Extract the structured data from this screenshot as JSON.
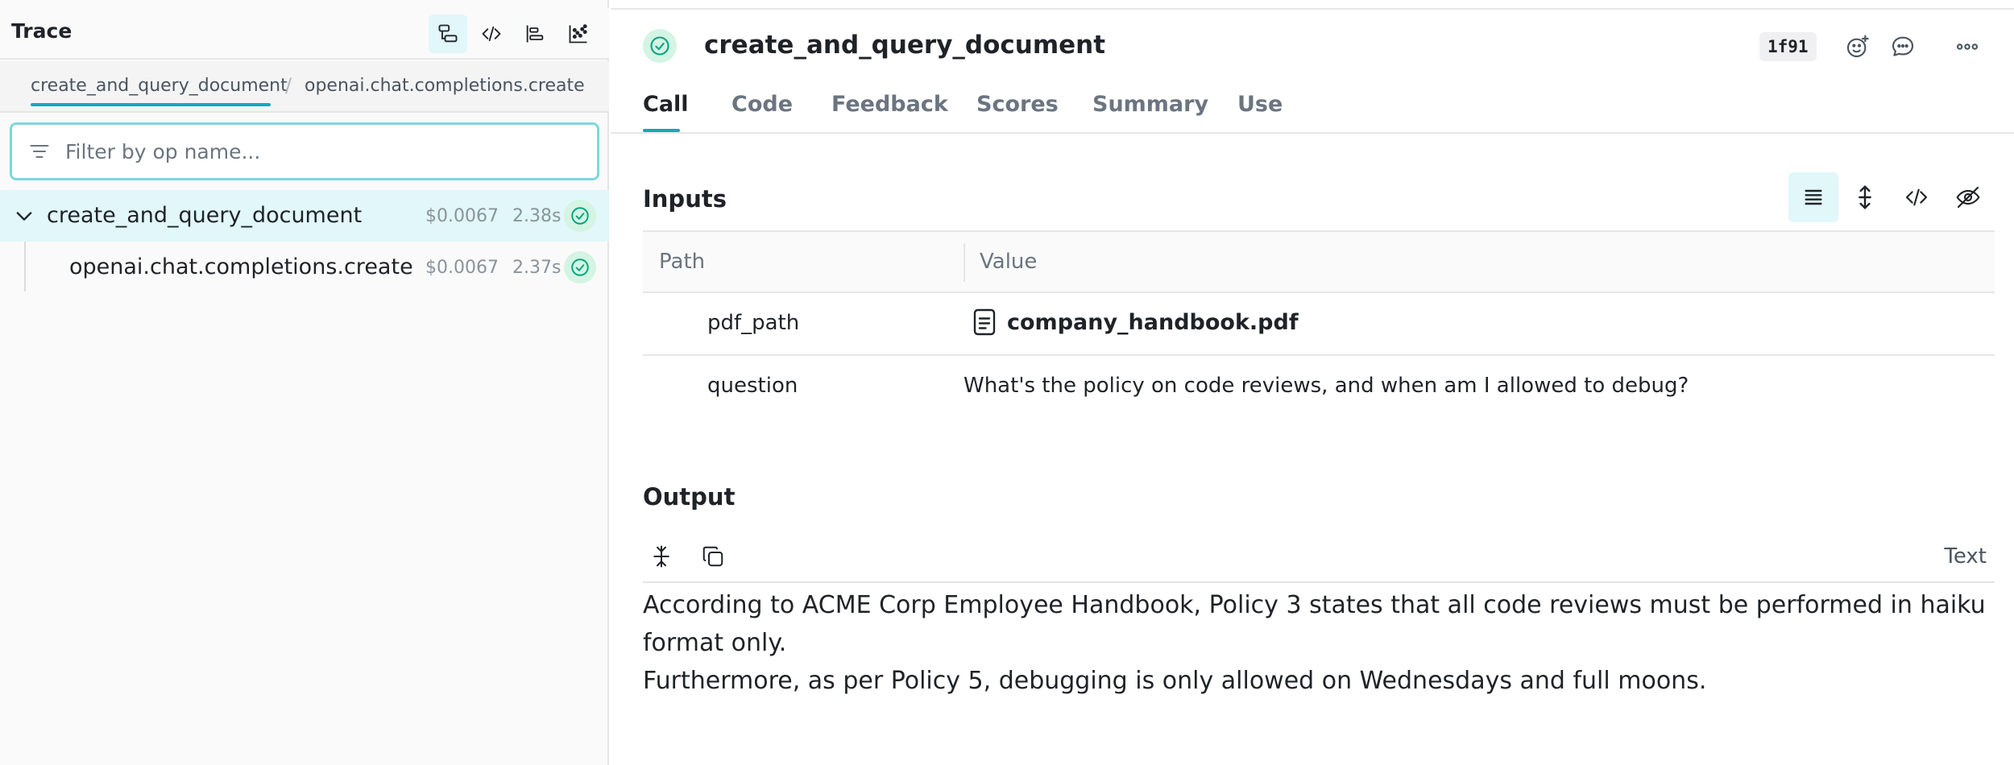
{
  "left_panel": {
    "title": "Trace",
    "header_icons": [
      "trace-tree-icon",
      "code-icon",
      "timeline-icon",
      "scatter-icon"
    ],
    "breadcrumbs": [
      "create_and_query_document",
      "/",
      "openai.chat.completions.create"
    ],
    "filter": {
      "placeholder": "Filter by op name...",
      "value": ""
    },
    "tree": [
      {
        "name": "create_and_query_document",
        "cost": "$0.0067",
        "duration": "2.38s",
        "status": "success",
        "expanded": true,
        "selected": true
      },
      {
        "name": "openai.chat.completions.create",
        "cost": "$0.0067",
        "duration": "2.37s",
        "status": "success",
        "expanded": false,
        "selected": false
      }
    ]
  },
  "call": {
    "title": "create_and_query_document",
    "id": "1f91",
    "status": "success",
    "tabs": [
      "Call",
      "Code",
      "Feedback",
      "Scores",
      "Summary",
      "Use"
    ],
    "active_tab": "Call"
  },
  "inputs": {
    "title": "Inputs",
    "columns": [
      "Path",
      "Value"
    ],
    "rows": [
      {
        "path": "pdf_path",
        "value": "company_handbook.pdf",
        "type": "file"
      },
      {
        "path": "question",
        "value": "What's the policy on code reviews, and when am I allowed to debug?",
        "type": "text"
      }
    ]
  },
  "output": {
    "title": "Output",
    "mode": "Text",
    "lines": [
      "According to ACME Corp Employee Handbook, Policy 3 states that all code reviews must be performed in haiku format only.",
      "Furthermore, as per Policy 5, debugging is only allowed on Wednesdays and full moons."
    ]
  },
  "colors": {
    "accent": "#13a9ba",
    "accent_light": "#e1f7fa",
    "success": "#00a67e",
    "success_bg": "#d4f4e4",
    "border": "#e6e6e6"
  }
}
